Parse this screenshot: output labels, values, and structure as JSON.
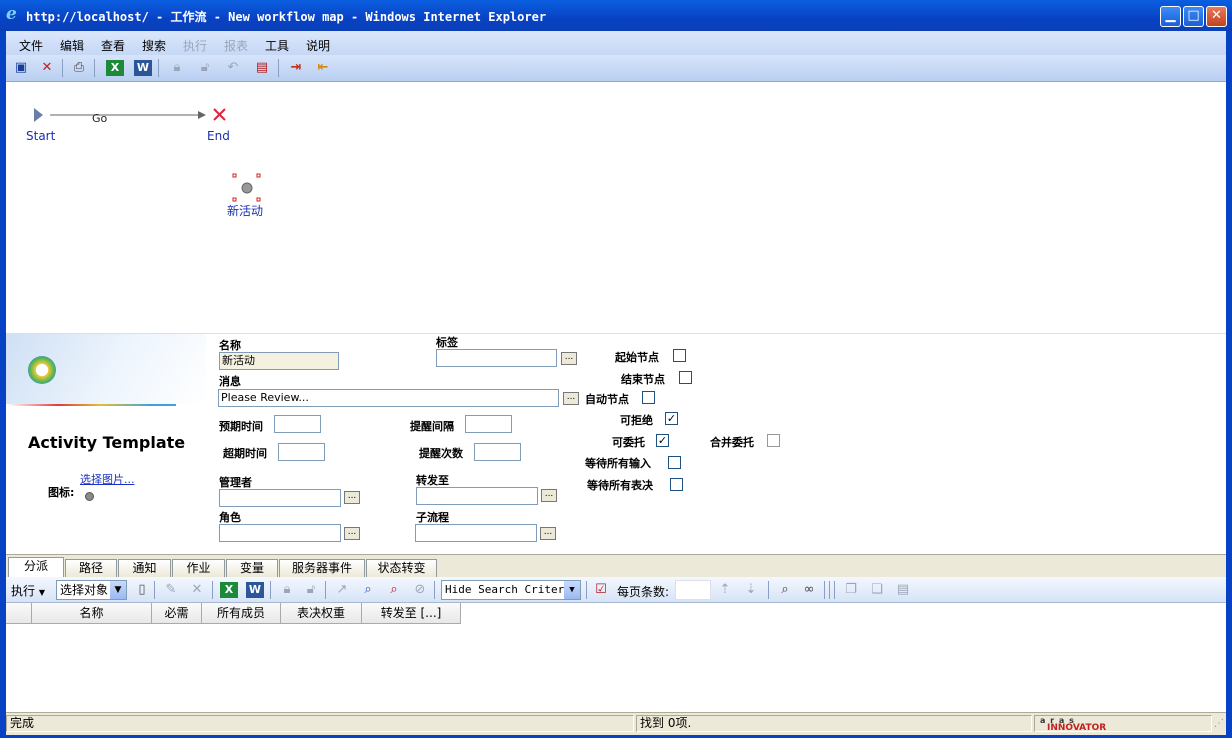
{
  "window": {
    "title": "http://localhost/ - 工作流 - New workflow map - Windows Internet Explorer",
    "min_glyph": "▁",
    "max_glyph": "□",
    "close_glyph": "✕"
  },
  "menu": {
    "items": [
      {
        "label": "文件",
        "enabled": true
      },
      {
        "label": "编辑",
        "enabled": true
      },
      {
        "label": "查看",
        "enabled": true
      },
      {
        "label": "搜索",
        "enabled": true
      },
      {
        "label": "执行",
        "enabled": false
      },
      {
        "label": "报表",
        "enabled": false
      },
      {
        "label": "工具",
        "enabled": true
      },
      {
        "label": "说明",
        "enabled": true
      }
    ]
  },
  "toolbar": {
    "icons": [
      "save-icon",
      "close-doc-icon",
      "print-icon",
      "excel-icon",
      "word-icon",
      "lock-icon",
      "unlock-icon",
      "undo-icon",
      "export-icon",
      "login-icon",
      "exit-icon"
    ]
  },
  "workflow": {
    "start_label": "Start",
    "end_label": "End",
    "path_label": "Go",
    "activity_label": "新活动"
  },
  "form": {
    "template_title": "Activity Template",
    "choose_image": "选择图片...",
    "icon_label": "图标:",
    "name_label": "名称",
    "name_value": "新活动",
    "tag_label": "标签",
    "message_label": "消息",
    "message_value": "Please Review...",
    "expected_time_label": "预期时间",
    "reminder_interval_label": "提醒间隔",
    "overdue_time_label": "超期时间",
    "reminder_count_label": "提醒次数",
    "manager_label": "管理者",
    "forward_to_label": "转发至",
    "role_label": "角色",
    "subflow_label": "子流程",
    "dots": "...",
    "start_node_label": "起始节点",
    "end_node_label": "结束节点",
    "auto_node_label": "自动节点",
    "can_reject_label": "可拒绝",
    "can_delegate_label": "可委托",
    "merge_delegate_label": "合并委托",
    "wait_all_inputs_label": "等待所有输入",
    "wait_all_votes_label": "等待所有表决",
    "checks": {
      "start": false,
      "end": false,
      "auto": false,
      "reject": true,
      "delegate": true,
      "merge": false,
      "wait_inputs": false,
      "wait_votes": false
    }
  },
  "tabs": [
    {
      "label": "分派",
      "active": true
    },
    {
      "label": "路径",
      "active": false
    },
    {
      "label": "通知",
      "active": false
    },
    {
      "label": "作业",
      "active": false
    },
    {
      "label": "变量",
      "active": false
    },
    {
      "label": "服务器事件",
      "active": false
    },
    {
      "label": "状态转变",
      "active": false
    }
  ],
  "grid_toolbar": {
    "execute_label": "执行",
    "select_target": "选择对象",
    "search_mode": "Hide Search Criteria",
    "per_page_label": "每页条数:",
    "per_page_value": ""
  },
  "grid": {
    "columns": [
      "",
      "名称",
      "必需",
      "所有成员",
      "表决权重",
      "转发至 [...]"
    ]
  },
  "status": {
    "left": "完成",
    "middle": "找到 0项.",
    "brand_top": "a r a s",
    "brand_bottom": "INNOVATOR"
  }
}
